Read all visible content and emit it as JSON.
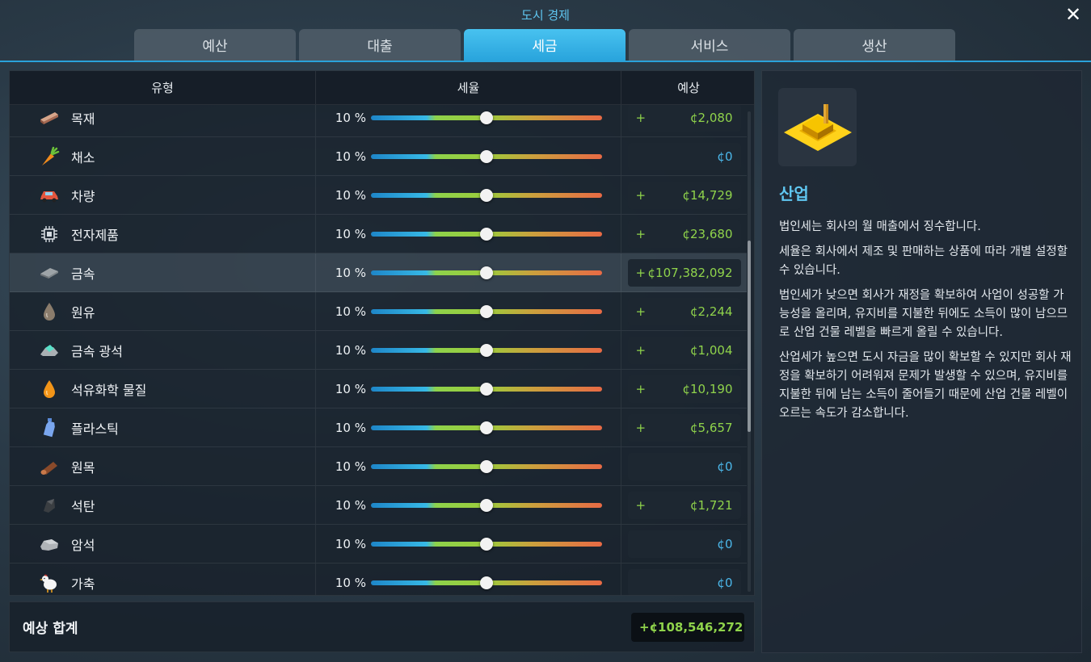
{
  "window": {
    "title": "도시 경제",
    "close_icon": "close-icon"
  },
  "tabs": [
    {
      "label": "예산",
      "active": false
    },
    {
      "label": "대출",
      "active": false
    },
    {
      "label": "세금",
      "active": true
    },
    {
      "label": "서비스",
      "active": false
    },
    {
      "label": "생산",
      "active": false
    }
  ],
  "table": {
    "headers": {
      "type": "유형",
      "rate": "세율",
      "estimate": "예상"
    },
    "rows": [
      {
        "name": "목재",
        "icon": "lumber-icon",
        "rate": "10 %",
        "rate_fraction": 0.5,
        "sign": "+",
        "estimate": "¢2,080",
        "positive": true
      },
      {
        "name": "채소",
        "icon": "carrot-icon",
        "rate": "10 %",
        "rate_fraction": 0.5,
        "sign": "",
        "estimate": "¢0",
        "positive": false
      },
      {
        "name": "차량",
        "icon": "car-icon",
        "rate": "10 %",
        "rate_fraction": 0.5,
        "sign": "+",
        "estimate": "¢14,729",
        "positive": true
      },
      {
        "name": "전자제품",
        "icon": "chip-icon",
        "rate": "10 %",
        "rate_fraction": 0.5,
        "sign": "+",
        "estimate": "¢23,680",
        "positive": true
      },
      {
        "name": "금속",
        "icon": "metal-plate-icon",
        "rate": "10 %",
        "rate_fraction": 0.5,
        "sign": "+",
        "estimate": "¢107,382,092",
        "positive": true,
        "highlight": true
      },
      {
        "name": "원유",
        "icon": "oil-drop-icon",
        "rate": "10 %",
        "rate_fraction": 0.5,
        "sign": "+",
        "estimate": "¢2,244",
        "positive": true
      },
      {
        "name": "금속 광석",
        "icon": "ore-icon",
        "rate": "10 %",
        "rate_fraction": 0.5,
        "sign": "+",
        "estimate": "¢1,004",
        "positive": true
      },
      {
        "name": "석유화학 물질",
        "icon": "petrochemical-drop-icon",
        "rate": "10 %",
        "rate_fraction": 0.5,
        "sign": "+",
        "estimate": "¢10,190",
        "positive": true
      },
      {
        "name": "플라스틱",
        "icon": "plastic-bottle-icon",
        "rate": "10 %",
        "rate_fraction": 0.5,
        "sign": "+",
        "estimate": "¢5,657",
        "positive": true
      },
      {
        "name": "원목",
        "icon": "log-icon",
        "rate": "10 %",
        "rate_fraction": 0.5,
        "sign": "",
        "estimate": "¢0",
        "positive": false
      },
      {
        "name": "석탄",
        "icon": "coal-icon",
        "rate": "10 %",
        "rate_fraction": 0.5,
        "sign": "+",
        "estimate": "¢1,721",
        "positive": true
      },
      {
        "name": "암석",
        "icon": "stone-icon",
        "rate": "10 %",
        "rate_fraction": 0.5,
        "sign": "",
        "estimate": "¢0",
        "positive": false
      },
      {
        "name": "가축",
        "icon": "chicken-icon",
        "rate": "10 %",
        "rate_fraction": 0.5,
        "sign": "",
        "estimate": "¢0",
        "positive": false
      }
    ]
  },
  "total": {
    "label": "예상 합계",
    "sign": "+",
    "value": "¢108,546,272"
  },
  "info": {
    "icon": "industry-zone-icon",
    "title": "산업",
    "paragraphs": [
      "법인세는 회사의 월 매출에서 징수합니다.",
      "세율은 회사에서 제조 및 판매하는 상품에 따라 개별 설정할 수 있습니다.",
      "법인세가 낮으면 회사가 재정을 확보하여 사업이 성공할 가능성을 올리며, 유지비를 지불한 뒤에도 소득이 많이 남으므로 산업 건물 레벨을 빠르게 올릴 수 있습니다.",
      "산업세가 높으면 도시 자금을 많이 확보할 수 있지만 회사 재정을 확보하기 어려워져 문제가 발생할 수 있으며, 유지비를 지불한 뒤에 남는 소득이 줄어들기 때문에 산업 건물 레벨이 오르는 속도가 감소합니다."
    ]
  },
  "colors": {
    "accent": "#2aa2da",
    "positive": "#8fd34b",
    "zero": "#4bb7ea",
    "title": "#5fc6f0"
  }
}
